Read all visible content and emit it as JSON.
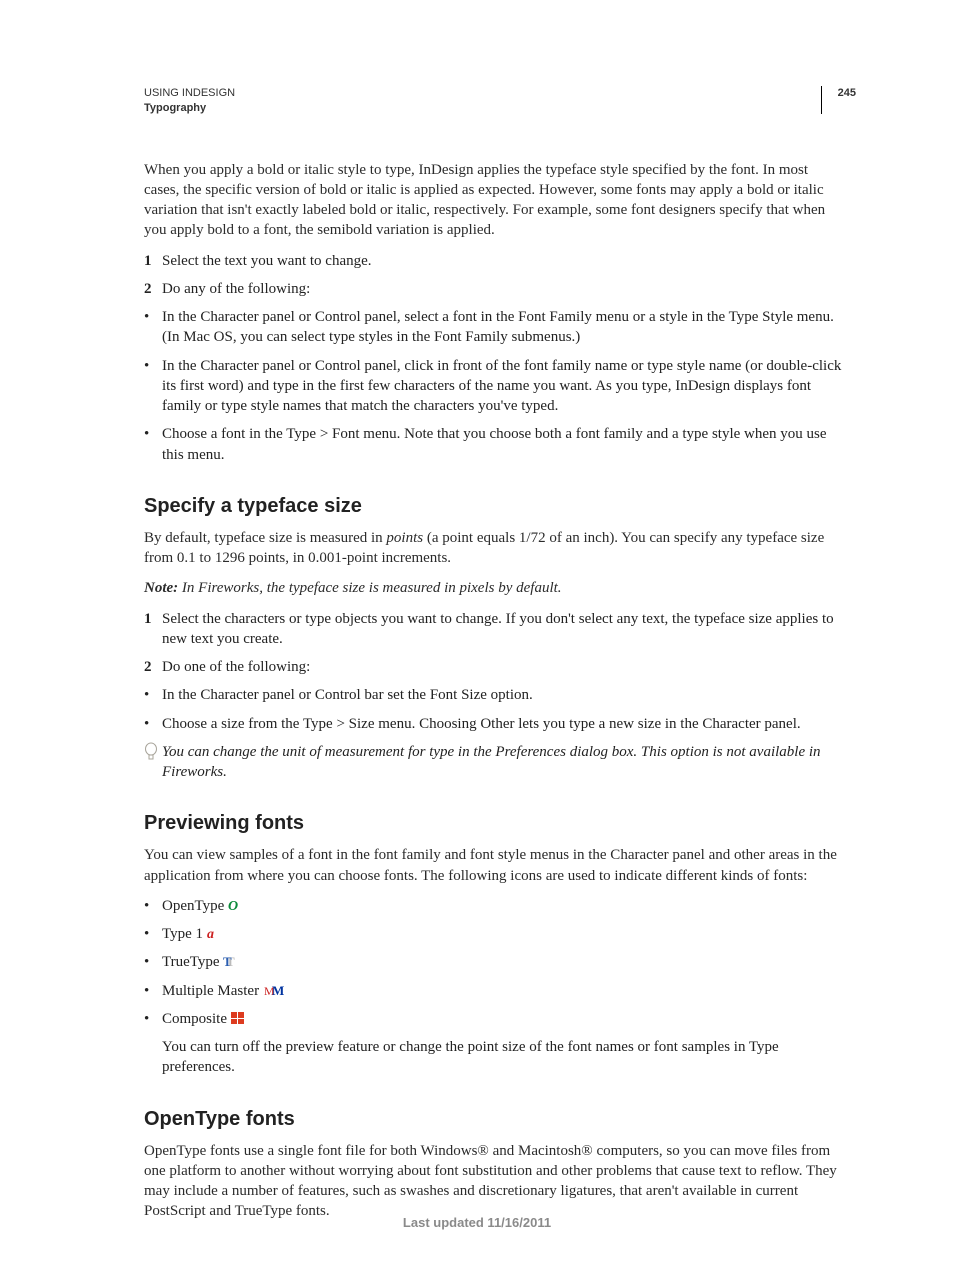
{
  "header": {
    "doc_title": "USING INDESIGN",
    "section": "Typography",
    "page_number": "245"
  },
  "intro_paragraph": "When you apply a bold or italic style to type, InDesign applies the typeface style specified by the font. In most cases, the specific version of bold or italic is applied as expected. However, some fonts may apply a bold or italic variation that isn't exactly labeled bold or italic, respectively. For example, some font designers specify that when you apply bold to a font, the semibold variation is applied.",
  "intro_steps": {
    "s1": "Select the text you want to change.",
    "s2": "Do any of the following:",
    "b1": "In the Character panel or Control panel, select a font in the Font Family menu or a style in the Type Style menu. (In Mac OS, you can select type styles in the Font Family submenus.)",
    "b2": "In the Character panel or Control panel, click in front of the font family name or type style name (or double-click its first word) and type in the first few characters of the name you want. As you type, InDesign displays font family or type style names that match the characters you've typed.",
    "b3": "Choose a font in the Type > Font menu. Note that you choose both a font family and a type style when you use this menu."
  },
  "size": {
    "heading": "Specify a typeface size",
    "para_a": "By default, typeface size is measured in ",
    "para_em": "points",
    "para_b": " (a point equals 1/72 of an inch). You can specify any typeface size from 0.1 to 1296 points, in 0.001-point increments.",
    "note_label": "Note: ",
    "note_text": "In Fireworks, the typeface size is measured in pixels by default.",
    "s1": "Select the characters or type objects you want to change. If you don't select any text, the typeface size applies to new text you create.",
    "s2": "Do one of the following:",
    "b1": "In the Character panel or Control bar set the Font Size option.",
    "b2": "Choose a size from the Type > Size menu. Choosing Other lets you type a new size in the Character panel.",
    "tip": "You can change the unit of measurement for type in the Preferences dialog box. This option is not available in Fireworks."
  },
  "preview": {
    "heading": "Previewing fonts",
    "para": "You can view samples of a font in the font family and font style menus in the Character panel and other areas in the application from where you can choose fonts. The following icons are used to indicate different kinds of fonts:",
    "items": {
      "opentype": "OpenType ",
      "type1": "Type 1 ",
      "truetype": "TrueType ",
      "mm": "Multiple Master ",
      "composite": "Composite "
    },
    "after": "You can turn off the preview feature or change the point size of the font names or font samples in Type preferences."
  },
  "opentype": {
    "heading": "OpenType fonts",
    "para": "OpenType fonts use a single font file for both Windows® and Macintosh® computers, so you can move files from one platform to another without worrying about font substitution and other problems that cause text to reflow. They may include a number of features, such as swashes and discretionary ligatures, that aren't available in current PostScript and TrueType fonts."
  },
  "footer": "Last updated 11/16/2011"
}
